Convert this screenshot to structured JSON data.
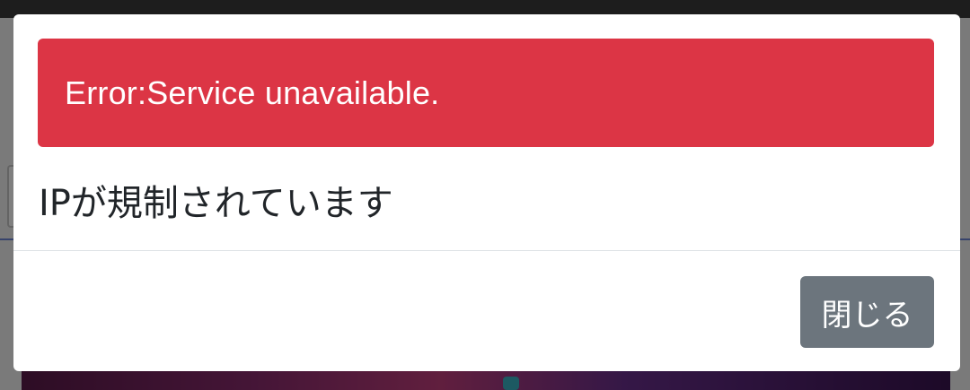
{
  "alert": {
    "text": "Error:Service unavailable.",
    "color": "#dc3545"
  },
  "modal": {
    "message": "IPが規制されています"
  },
  "footer": {
    "close_label": "閉じる",
    "button_color": "#6c757d"
  }
}
